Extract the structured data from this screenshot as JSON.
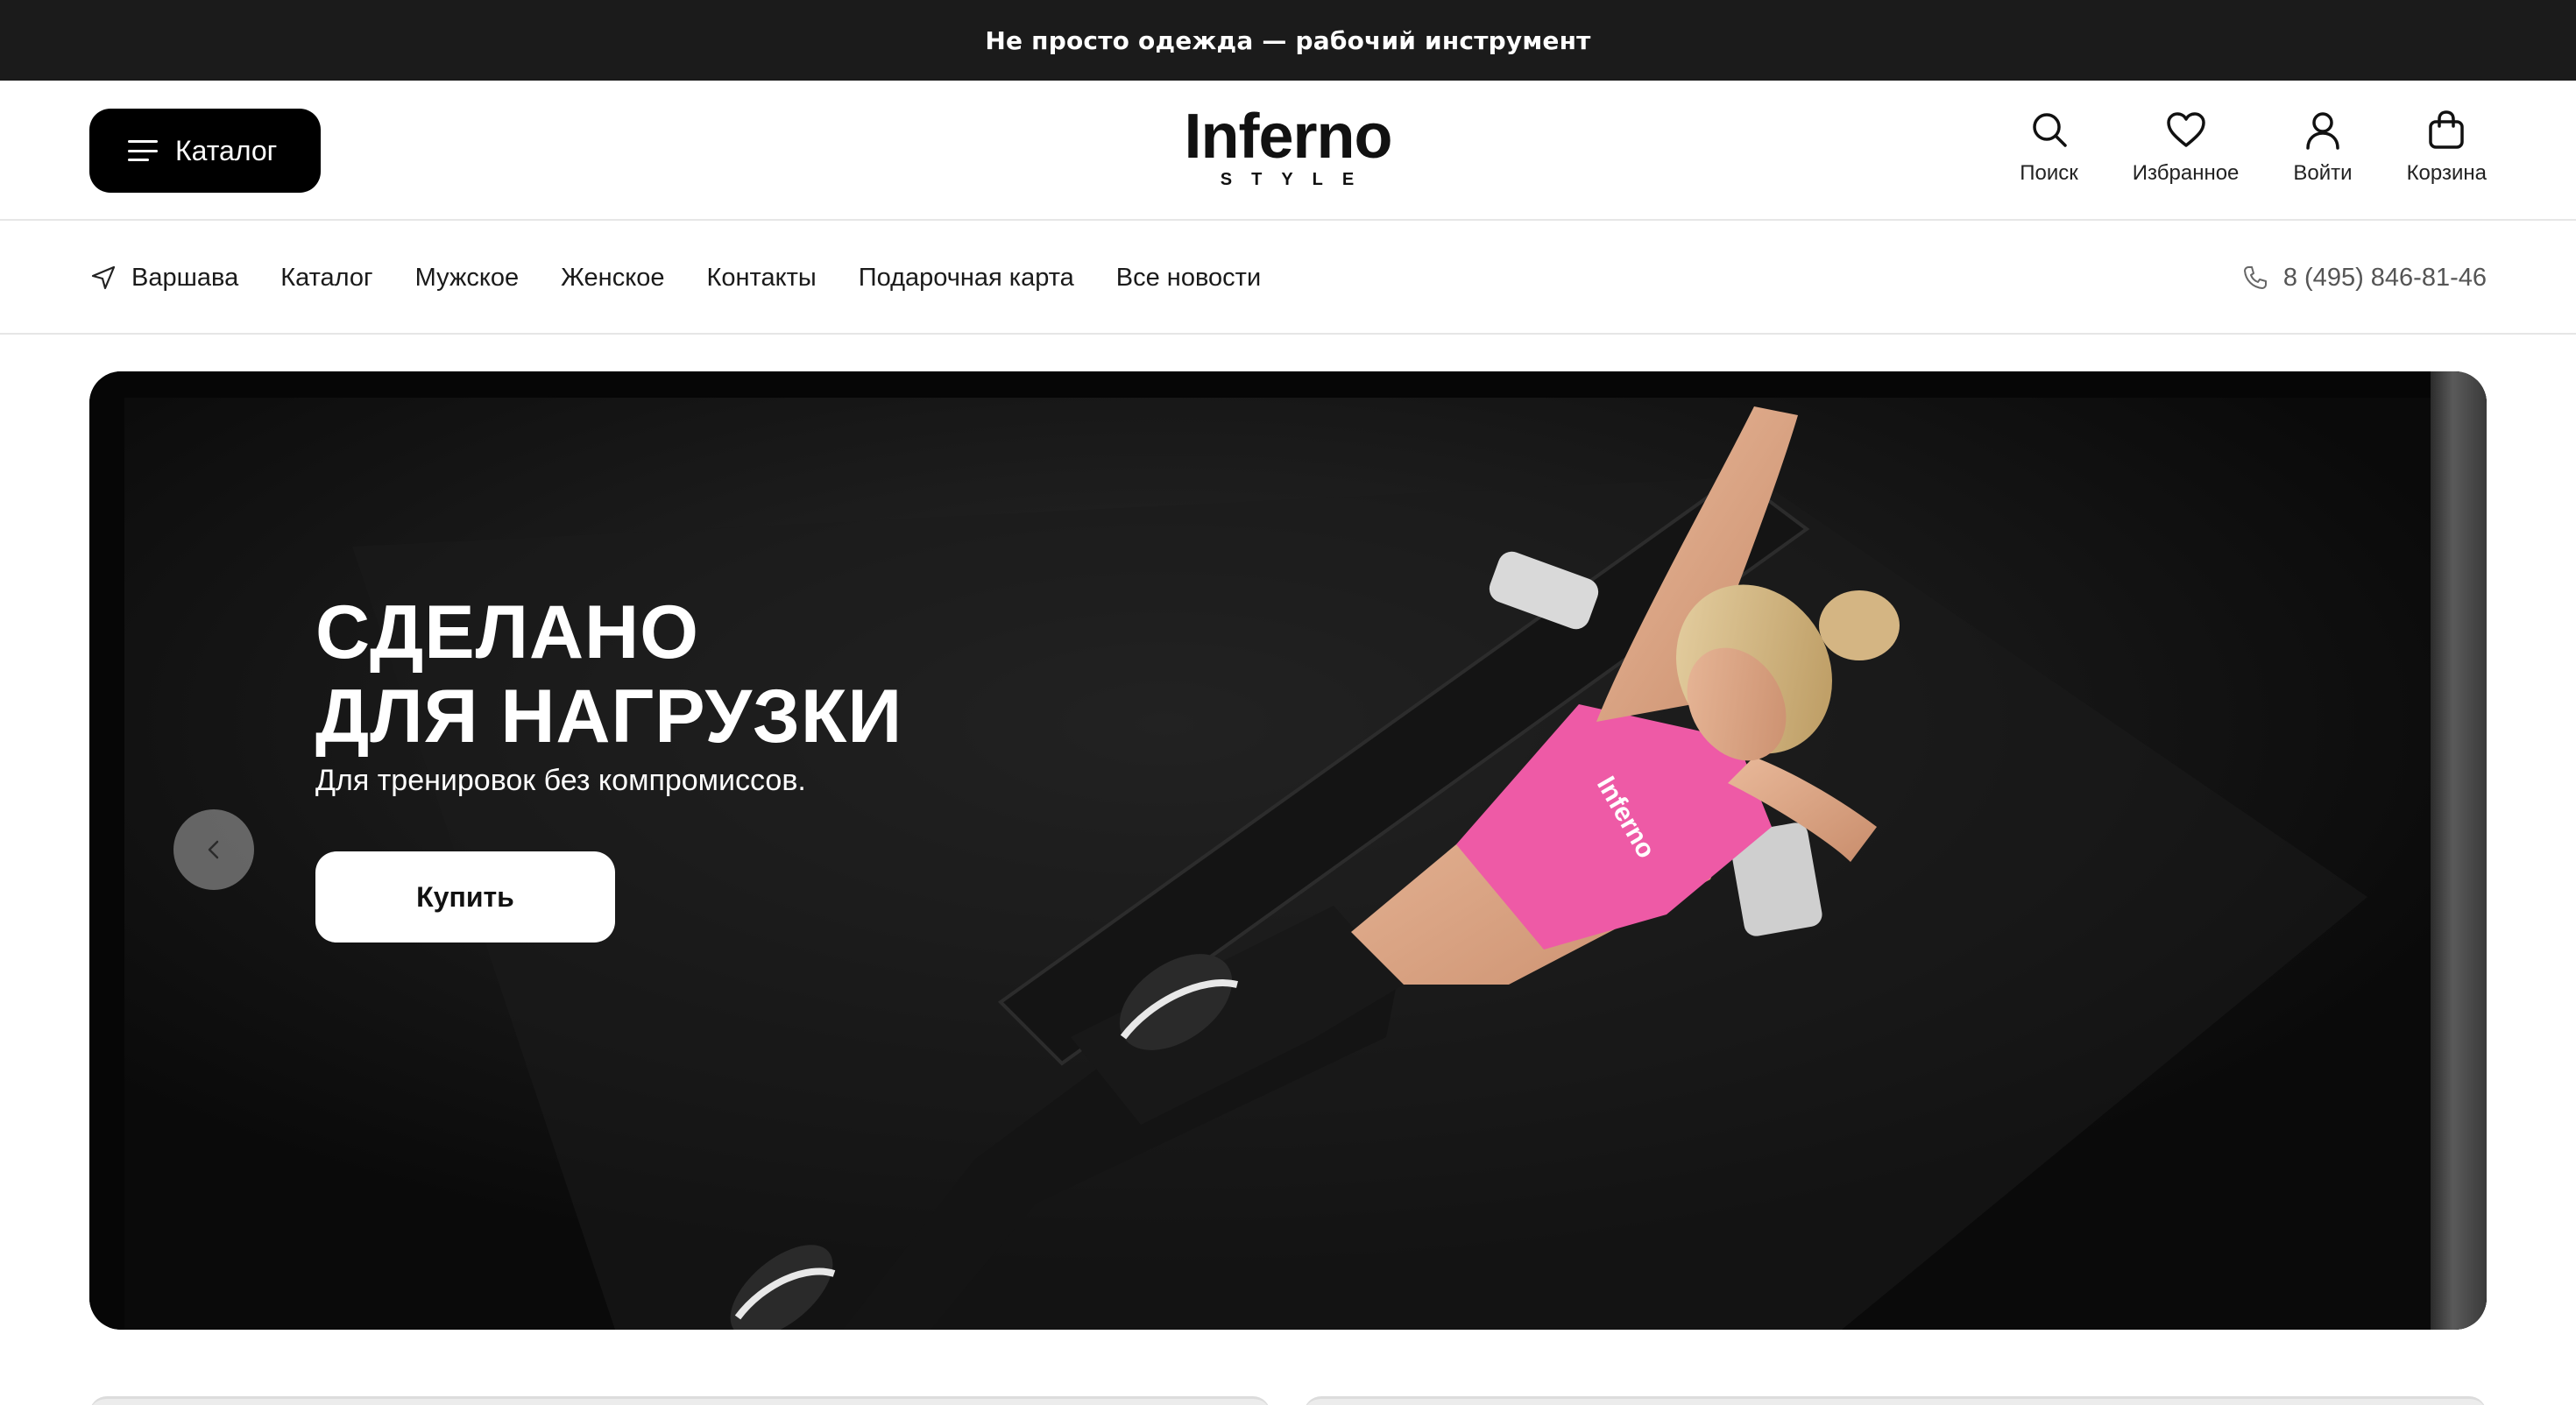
{
  "topbar": {
    "text": "Не просто одежда — рабочий инструмент"
  },
  "header": {
    "catalog_label": "Каталог",
    "logo_main": "Inferno",
    "logo_sub": "STYLE",
    "actions": [
      {
        "label": "Поиск",
        "icon": "search-icon"
      },
      {
        "label": "Избранное",
        "icon": "heart-icon"
      },
      {
        "label": "Войти",
        "icon": "user-icon"
      },
      {
        "label": "Корзина",
        "icon": "bag-icon"
      }
    ]
  },
  "nav": {
    "city": "Варшава",
    "items": [
      "Каталог",
      "Мужское",
      "Женское",
      "Контакты",
      "Подарочная карта",
      "Все новости"
    ],
    "phone": "8 (495) 846-81-46"
  },
  "hero": {
    "title_line1": "СДЕЛАНО",
    "title_line2": "ДЛЯ НАГРУЗКИ",
    "subtitle": "Для тренировок без компромиссов.",
    "button": "Купить",
    "shirt_text": "Inferno"
  },
  "colors": {
    "topbar_bg": "#1b1b1b",
    "accent_pink": "#ee5aa6",
    "hero_bg": "#0b0b0b"
  }
}
